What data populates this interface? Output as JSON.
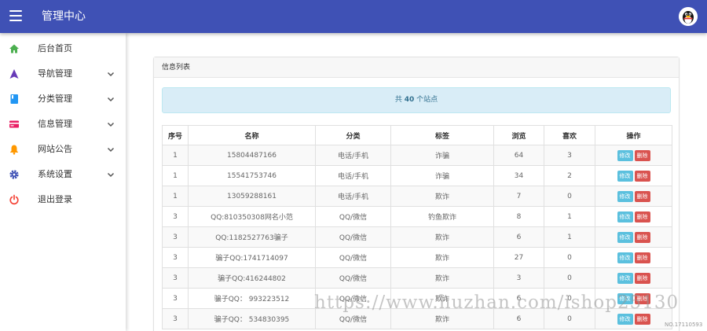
{
  "header": {
    "title": "管理中心"
  },
  "sidebar": {
    "items": [
      {
        "label": "后台首页",
        "icon": "home-icon",
        "color": "#4caf50",
        "has_children": false
      },
      {
        "label": "导航管理",
        "icon": "navigation-icon",
        "color": "#673ab7",
        "has_children": true
      },
      {
        "label": "分类管理",
        "icon": "book-icon",
        "color": "#2196f3",
        "has_children": true
      },
      {
        "label": "信息管理",
        "icon": "credit-card-icon",
        "color": "#e91e63",
        "has_children": true
      },
      {
        "label": "网站公告",
        "icon": "bell-icon",
        "color": "#ff9800",
        "has_children": true
      },
      {
        "label": "系统设置",
        "icon": "gear-icon",
        "color": "#3f51b5",
        "has_children": true
      },
      {
        "label": "退出登录",
        "icon": "power-icon",
        "color": "#f44336",
        "has_children": false
      }
    ]
  },
  "card": {
    "title": "信息列表",
    "summary": {
      "prefix": "共 ",
      "count": "40",
      "suffix": " 个站点"
    }
  },
  "table": {
    "headers": [
      "序号",
      "名称",
      "分类",
      "标签",
      "浏览",
      "喜欢",
      "操作"
    ],
    "edit_label": "修改",
    "delete_label": "删除",
    "rows": [
      [
        "1",
        "15804487166",
        "电话/手机",
        "诈骗",
        "64",
        "3"
      ],
      [
        "1",
        "15541753746",
        "电话/手机",
        "诈骗",
        "34",
        "2"
      ],
      [
        "1",
        "13059288161",
        "电话/手机",
        "欺诈",
        "7",
        "0"
      ],
      [
        "3",
        "QQ:810350308网名小范",
        "QQ/微信",
        "钓鱼欺诈",
        "8",
        "1"
      ],
      [
        "3",
        "QQ:1182527763骗子",
        "QQ/微信",
        "欺诈",
        "6",
        "1"
      ],
      [
        "3",
        "骗子QQ:1741714097",
        "QQ/微信",
        "欺诈",
        "27",
        "0"
      ],
      [
        "3",
        "骗子QQ:416244802",
        "QQ/微信",
        "欺诈",
        "3",
        "0"
      ],
      [
        "3",
        "骗子QQ： 993223512",
        "QQ/微信",
        "欺诈",
        "6",
        "0"
      ],
      [
        "3",
        "骗子QQ： 534830395",
        "QQ/微信",
        "欺诈",
        "6",
        "0"
      ]
    ]
  },
  "watermark": "https://www.huzhan.com/ishop25130",
  "stamp": "NO.17110593",
  "colors": {
    "topbar": "#3f51b5",
    "summary_bg": "#d9edf7",
    "summary_text": "#31708f",
    "edit_button": "#5bc0de",
    "delete_button": "#d9534f"
  }
}
